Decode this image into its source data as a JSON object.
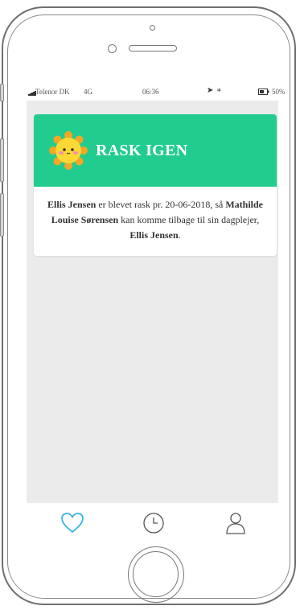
{
  "status_bar": {
    "carrier": "Telenor DK",
    "network": "4G",
    "time": "06:36",
    "battery_text": "50%"
  },
  "card": {
    "title": "RASK IGEN",
    "header_color": "#22cc8f",
    "icon": "sun-icon",
    "message": {
      "caregiver_name": "Ellis Jensen",
      "text_1": " er blevet rask pr. 20-06-2018, så ",
      "child_name": "Mathilde Louise Sørensen",
      "text_2": " kan komme tilbage til sin dagplejer, ",
      "caregiver_name_2": "Ellis Jensen",
      "text_3": "."
    }
  },
  "tabbar": {
    "tabs": [
      {
        "icon": "heart-icon",
        "active": true,
        "color": "#3ab4e6"
      },
      {
        "icon": "clock-icon",
        "active": false,
        "color": "#555555"
      },
      {
        "icon": "user-icon",
        "active": false,
        "color": "#555555"
      }
    ]
  }
}
